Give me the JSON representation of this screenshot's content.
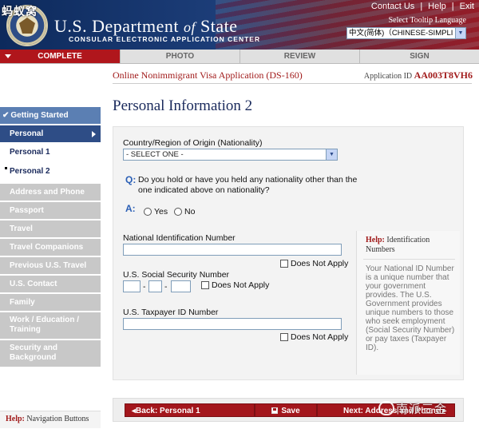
{
  "header": {
    "watermark": "蚂蚁窝",
    "title_main": "U.S. Department",
    "title_of": "of",
    "title_state": "State",
    "subtitle": "CONSULAR ELECTRONIC APPLICATION CENTER",
    "links": [
      "Contact Us",
      "Help",
      "Exit"
    ],
    "tooltip_label": "Select Tooltip Language",
    "language_value": "中文(简体)（CHINESE-SIMPLI"
  },
  "steps": [
    {
      "label": "COMPLETE",
      "active": true
    },
    {
      "label": "PHOTO",
      "active": false
    },
    {
      "label": "REVIEW",
      "active": false
    },
    {
      "label": "SIGN",
      "active": false
    }
  ],
  "banner": {
    "app_title": "Online Nonimmigrant Visa Application (DS-160)",
    "app_id_label": "Application ID",
    "app_id": "AA003T8VH6"
  },
  "sidebar": {
    "items": [
      {
        "label": "Getting Started"
      },
      {
        "label": "Personal"
      },
      {
        "label": "Personal 1"
      },
      {
        "label": "Personal 2"
      },
      {
        "label": "Address and Phone"
      },
      {
        "label": "Passport"
      },
      {
        "label": "Travel"
      },
      {
        "label": "Travel Companions"
      },
      {
        "label": "Previous U.S. Travel"
      },
      {
        "label": "U.S. Contact"
      },
      {
        "label": "Family"
      },
      {
        "label": "Work / Education / Training"
      },
      {
        "label": "Security and Background"
      }
    ],
    "help_label": "Help:",
    "help_text": "Navigation Buttons"
  },
  "main": {
    "page_title": "Personal Information 2",
    "nationality_label": "Country/Region of Origin (Nationality)",
    "nationality_value": "- SELECT ONE -",
    "q_mark": "Q:",
    "question": "Do you hold or have you held any nationality other than the one indicated above on nationality?",
    "a_mark": "A:",
    "yes_label": "Yes",
    "no_label": "No",
    "nin_label": "National Identification Number",
    "ssn_label": "U.S. Social Security Number",
    "taxpayer_label": "U.S. Taxpayer ID Number",
    "does_not_apply": "Does Not Apply",
    "ssn_dash": "-",
    "help_label": "Help:",
    "help_title": "Identification Numbers",
    "help_text": "Your National ID Number is a unique number that your government provides. The U.S. Government provides unique numbers to those who seek employment (Social Security Number) or pay taxes (Taxpayer ID)."
  },
  "nav": {
    "back_label": "Back: Personal 1",
    "save_label": "Save",
    "next_label": "Next: Address and Phone"
  },
  "watermark_bottom": "南派三金"
}
